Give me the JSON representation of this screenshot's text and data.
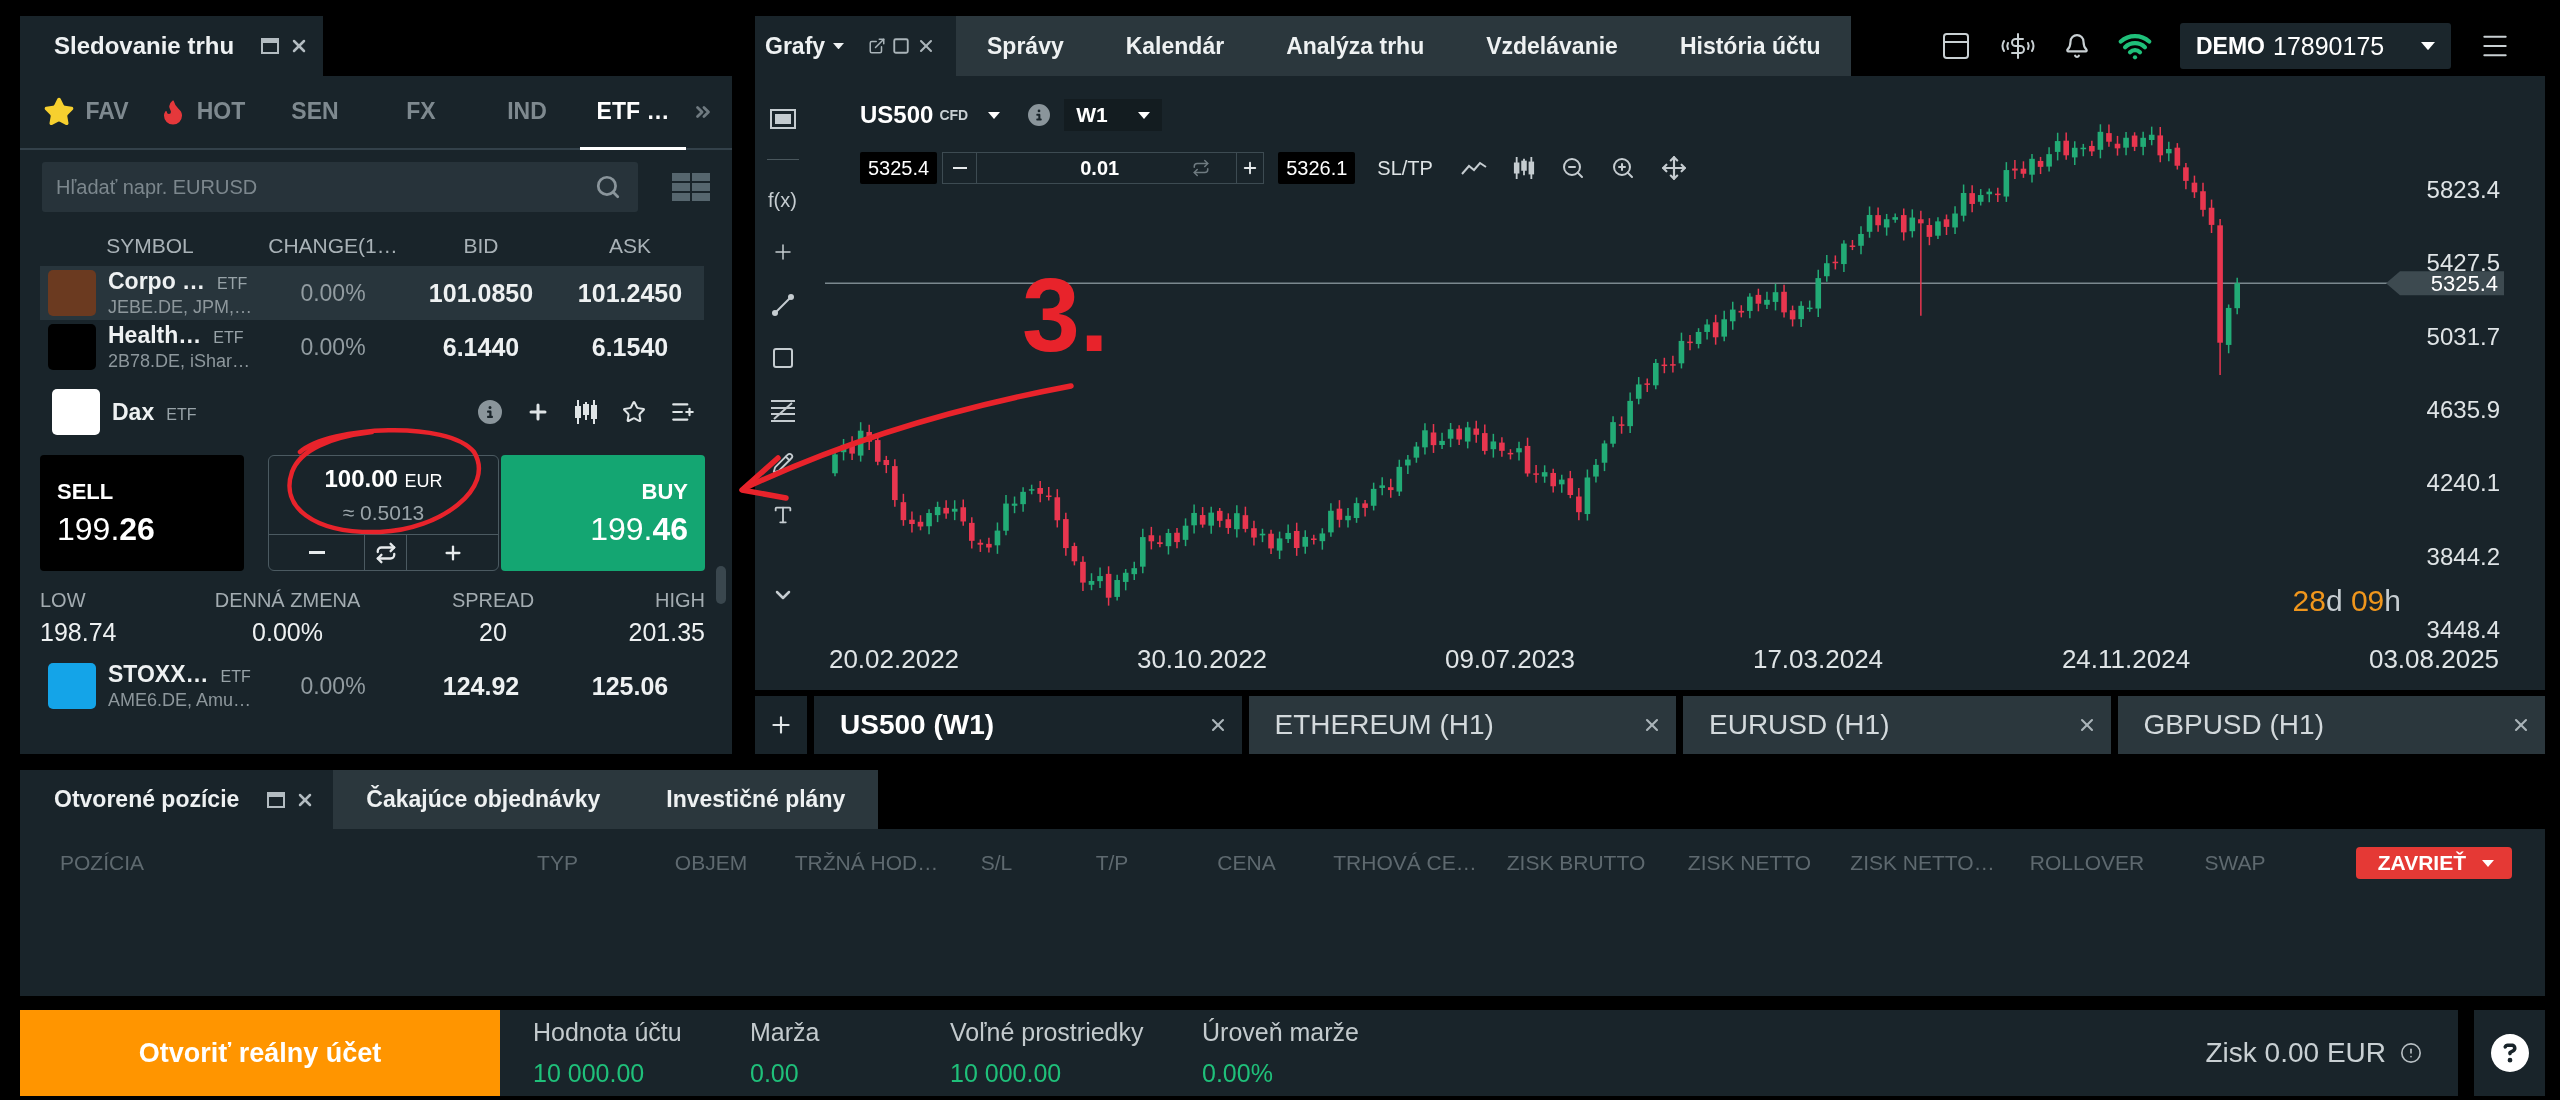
{
  "watchlist": {
    "title": "Sledovanie trhu",
    "categories": [
      {
        "label": "FAV",
        "selected": false
      },
      {
        "label": "HOT",
        "selected": false
      },
      {
        "label": "SEN",
        "selected": false
      },
      {
        "label": "FX",
        "selected": false
      },
      {
        "label": "IND",
        "selected": false
      },
      {
        "label": "ETF …",
        "selected": true
      }
    ],
    "search": {
      "placeholder": "Hľadať napr. EURUSD"
    },
    "columns": [
      "SYMBOL",
      "CHANGE(1…",
      "BID",
      "ASK"
    ],
    "rows": [
      {
        "kind": "quote",
        "name": "Corpo …",
        "type": "ETF",
        "sub": "JEBE.DE, JPM,…",
        "change": "0.00%",
        "bid": "101.0850",
        "ask": "101.2450",
        "color": "#6b3a20",
        "selected": true
      },
      {
        "kind": "quote",
        "name": "Health…",
        "type": "ETF",
        "sub": "2B78.DE, iShar…",
        "change": "0.00%",
        "bid": "6.1440",
        "ask": "6.1540",
        "color": "#000000",
        "selected": false
      },
      {
        "kind": "expanded",
        "header": {
          "name": "Dax",
          "type": "ETF"
        },
        "color": "#ffffff",
        "selected": false,
        "trade": {
          "sell_label": "SELL",
          "sell_price": "199.**26**",
          "amount": "100.00",
          "currency": "EUR",
          "approx": "≈ 0.5013",
          "buy_label": "BUY",
          "buy_price": "199.**46**"
        },
        "stats": [
          {
            "label": "LOW",
            "value": "198.74"
          },
          {
            "label": "DENNÁ ZMENA",
            "value": "0.00%"
          },
          {
            "label": "SPREAD",
            "value": "20"
          },
          {
            "label": "HIGH",
            "value": "201.35"
          }
        ]
      },
      {
        "kind": "quote",
        "name": "STOXX…",
        "type": "ETF",
        "sub": "AME6.DE, Amu…",
        "change": "0.00%",
        "bid": "124.92",
        "ask": "125.06",
        "color": "#14a4e8",
        "selected": false
      }
    ]
  },
  "top_nav": {
    "tabs": [
      {
        "label": "Grafy",
        "menu": true,
        "selected": true
      },
      {
        "label": "Správy",
        "selected": false
      },
      {
        "label": "Kalendár",
        "selected": false
      },
      {
        "label": "Analýza trhu",
        "selected": false
      },
      {
        "label": "Vzdelávanie",
        "selected": false
      },
      {
        "label": "História účtu",
        "selected": false
      }
    ],
    "account": {
      "mode": "DEMO",
      "number": "17890175"
    }
  },
  "chart": {
    "symbol": "US500",
    "symbol_type": "CFD",
    "timeframe": "W1",
    "sell_price": "5325.4",
    "quantity": "0.01",
    "buy_price": "5326.1",
    "sltp": "SL/TP",
    "formula_tool": "f(x)",
    "price_labels": [
      "5823.4",
      "5427.5",
      "5031.7",
      "4635.9",
      "4240.1",
      "3844.2",
      "3448.4"
    ],
    "current_price": "5325.4",
    "date_labels": [
      "20.02.2022",
      "30.10.2022",
      "09.07.2023",
      "17.03.2024",
      "24.11.2024",
      "03.08.2025"
    ],
    "countdown": [
      {
        "value": "28",
        "unit": "d"
      },
      {
        "value": "09",
        "unit": "h"
      }
    ]
  },
  "chart_tabs": [
    {
      "label": "US500 (W1)",
      "selected": true
    },
    {
      "label": "ETHEREUM (H1)",
      "selected": false
    },
    {
      "label": "EURUSD (H1)",
      "selected": false
    },
    {
      "label": "GBPUSD (H1)",
      "selected": false
    }
  ],
  "positions": {
    "tabs": [
      {
        "label": "Otvorené pozície",
        "selected": true
      },
      {
        "label": "Čakajúce objednávky",
        "selected": false
      },
      {
        "label": "Investičné plány",
        "selected": false
      }
    ],
    "columns": [
      "POZÍCIA",
      "TYP",
      "OBJEM",
      "TRŽNÁ HOD…",
      "S/L",
      "T/P",
      "CENA",
      "TRHOVÁ CE…",
      "ZISK BRUTTO",
      "ZISK NETTO",
      "ZISK NETTO…",
      "ROLLOVER",
      "SWAP"
    ],
    "close_button": "ZAVRIEŤ"
  },
  "footer": {
    "open_account": "Otvoriť reálny účet",
    "stats": [
      {
        "label": "Hodnota účtu",
        "value": "10 000.00"
      },
      {
        "label": "Marža",
        "value": "0.00"
      },
      {
        "label": "Voľné prostriedky",
        "value": "10 000.00"
      },
      {
        "label": "Úroveň marže",
        "value": "0.00%"
      }
    ],
    "profit": "Zisk 0.00 EUR"
  },
  "annotation": {
    "step": "3."
  }
}
